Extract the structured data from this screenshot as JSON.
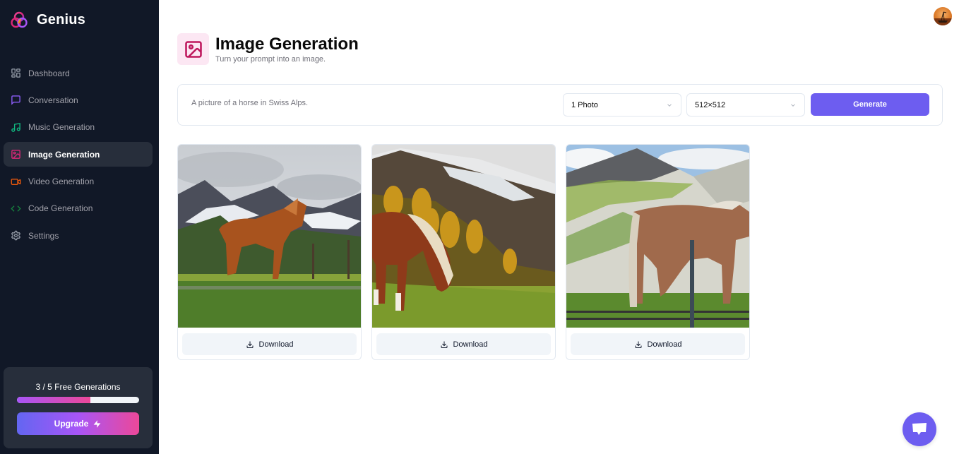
{
  "app": {
    "name": "Genius",
    "brand_colors": {
      "sidebar_bg": "#111827",
      "accent": "#6d5df0",
      "gradient_start": "#6366f1",
      "gradient_mid": "#a855f7",
      "gradient_end": "#ec4899"
    }
  },
  "sidebar": {
    "items": [
      {
        "label": "Dashboard",
        "icon": "layout-dashboard-icon",
        "color": "#9ca3af",
        "active": false
      },
      {
        "label": "Conversation",
        "icon": "message-square-icon",
        "color": "#8b5cf6",
        "active": false
      },
      {
        "label": "Music Generation",
        "icon": "music-icon",
        "color": "#10b981",
        "active": false
      },
      {
        "label": "Image Generation",
        "icon": "image-icon",
        "color": "#db2777",
        "active": true
      },
      {
        "label": "Video Generation",
        "icon": "video-icon",
        "color": "#ea580c",
        "active": false
      },
      {
        "label": "Code Generation",
        "icon": "code-icon",
        "color": "#15803d",
        "active": false
      },
      {
        "label": "Settings",
        "icon": "settings-icon",
        "color": "#9ca3af",
        "active": false
      }
    ],
    "credits": {
      "used": 3,
      "limit": 5,
      "text": "3 / 5 Free Generations",
      "progress_fraction": 0.6
    },
    "upgrade_label": "Upgrade"
  },
  "header": {
    "title": "Image Generation",
    "subtitle": "Turn your prompt into an image.",
    "icon": "image-icon",
    "icon_color": "#be185d",
    "icon_bg": "#fce7f3"
  },
  "form": {
    "prompt_value": "",
    "prompt_placeholder": "A picture of a horse in Swiss Alps.",
    "amount_selected": "1 Photo",
    "resolution_selected": "512×512",
    "generate_label": "Generate"
  },
  "results": [
    {
      "description": "Chestnut horse standing on grassy meadow before snowy peaks under cloudy sky",
      "download_label": "Download"
    },
    {
      "description": "Horse with blond mane grazing on hillside with autumn larches and misty mountain",
      "download_label": "Download"
    },
    {
      "description": "Brown horse with pale tail beside a fence post on a steep green-and-white mountain slope",
      "download_label": "Download"
    }
  ]
}
